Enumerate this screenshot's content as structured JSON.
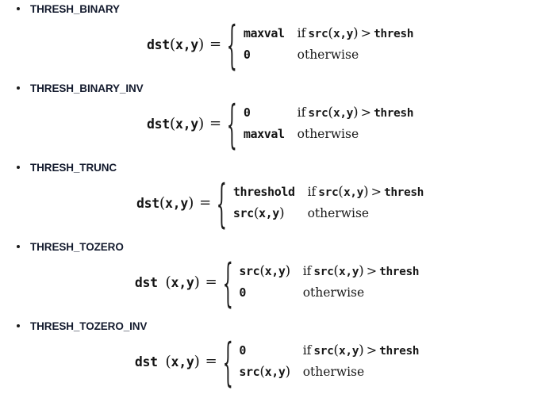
{
  "page": {
    "background_color": "#ffffff",
    "text_color": "#141414",
    "heading_color": "#141b2e"
  },
  "symbols": {
    "bullet": "•",
    "equals": "=",
    "brace_open": "{",
    "greater_than": ">",
    "paren_open": "(",
    "paren_close": ")",
    "comma": ",",
    "if_word": "if",
    "otherwise_word": "otherwise"
  },
  "common": {
    "dst_name": "dst",
    "src_name": "src",
    "arg_x": "x",
    "arg_y": "y",
    "thresh_name": "thresh",
    "lhs_text": "dst",
    "condition_tail": "thresh"
  },
  "blocks": [
    {
      "id": "thresh-binary",
      "label": "THRESH_BINARY",
      "formula": {
        "lhs": "dst(x,y)",
        "cases": [
          {
            "value": "maxval",
            "condition": "if src(x,y) > thresh",
            "condition_kind": "if"
          },
          {
            "value": "0",
            "condition": "otherwise",
            "condition_kind": "otherwise"
          }
        ]
      }
    },
    {
      "id": "thresh-binary-inv",
      "label": "THRESH_BINARY_INV",
      "formula": {
        "lhs": "dst(x,y)",
        "cases": [
          {
            "value": "0",
            "condition": "if src(x,y) > thresh",
            "condition_kind": "if"
          },
          {
            "value": "maxval",
            "condition": "otherwise",
            "condition_kind": "otherwise"
          }
        ]
      }
    },
    {
      "id": "thresh-trunc",
      "label": "THRESH_TRUNC",
      "formula": {
        "lhs": "dst(x,y)",
        "cases": [
          {
            "value": "threshold",
            "condition": "if src(x,y) > thresh",
            "condition_kind": "if"
          },
          {
            "value": "src(x,y)",
            "condition": "otherwise",
            "condition_kind": "otherwise"
          }
        ]
      }
    },
    {
      "id": "thresh-tozero",
      "label": "THRESH_TOZERO",
      "formula": {
        "lhs": "dst(x,y)",
        "cases": [
          {
            "value": "src(x,y)",
            "condition": "if src(x,y) > thresh",
            "condition_kind": "if"
          },
          {
            "value": "0",
            "condition": "otherwise",
            "condition_kind": "otherwise"
          }
        ]
      }
    },
    {
      "id": "thresh-tozero-inv",
      "label": "THRESH_TOZERO_INV",
      "formula": {
        "lhs": "dst(x,y)",
        "cases": [
          {
            "value": "0",
            "condition": "if src(x,y) > thresh",
            "condition_kind": "if"
          },
          {
            "value": "src(x,y)",
            "condition": "otherwise",
            "condition_kind": "otherwise"
          }
        ]
      }
    }
  ]
}
